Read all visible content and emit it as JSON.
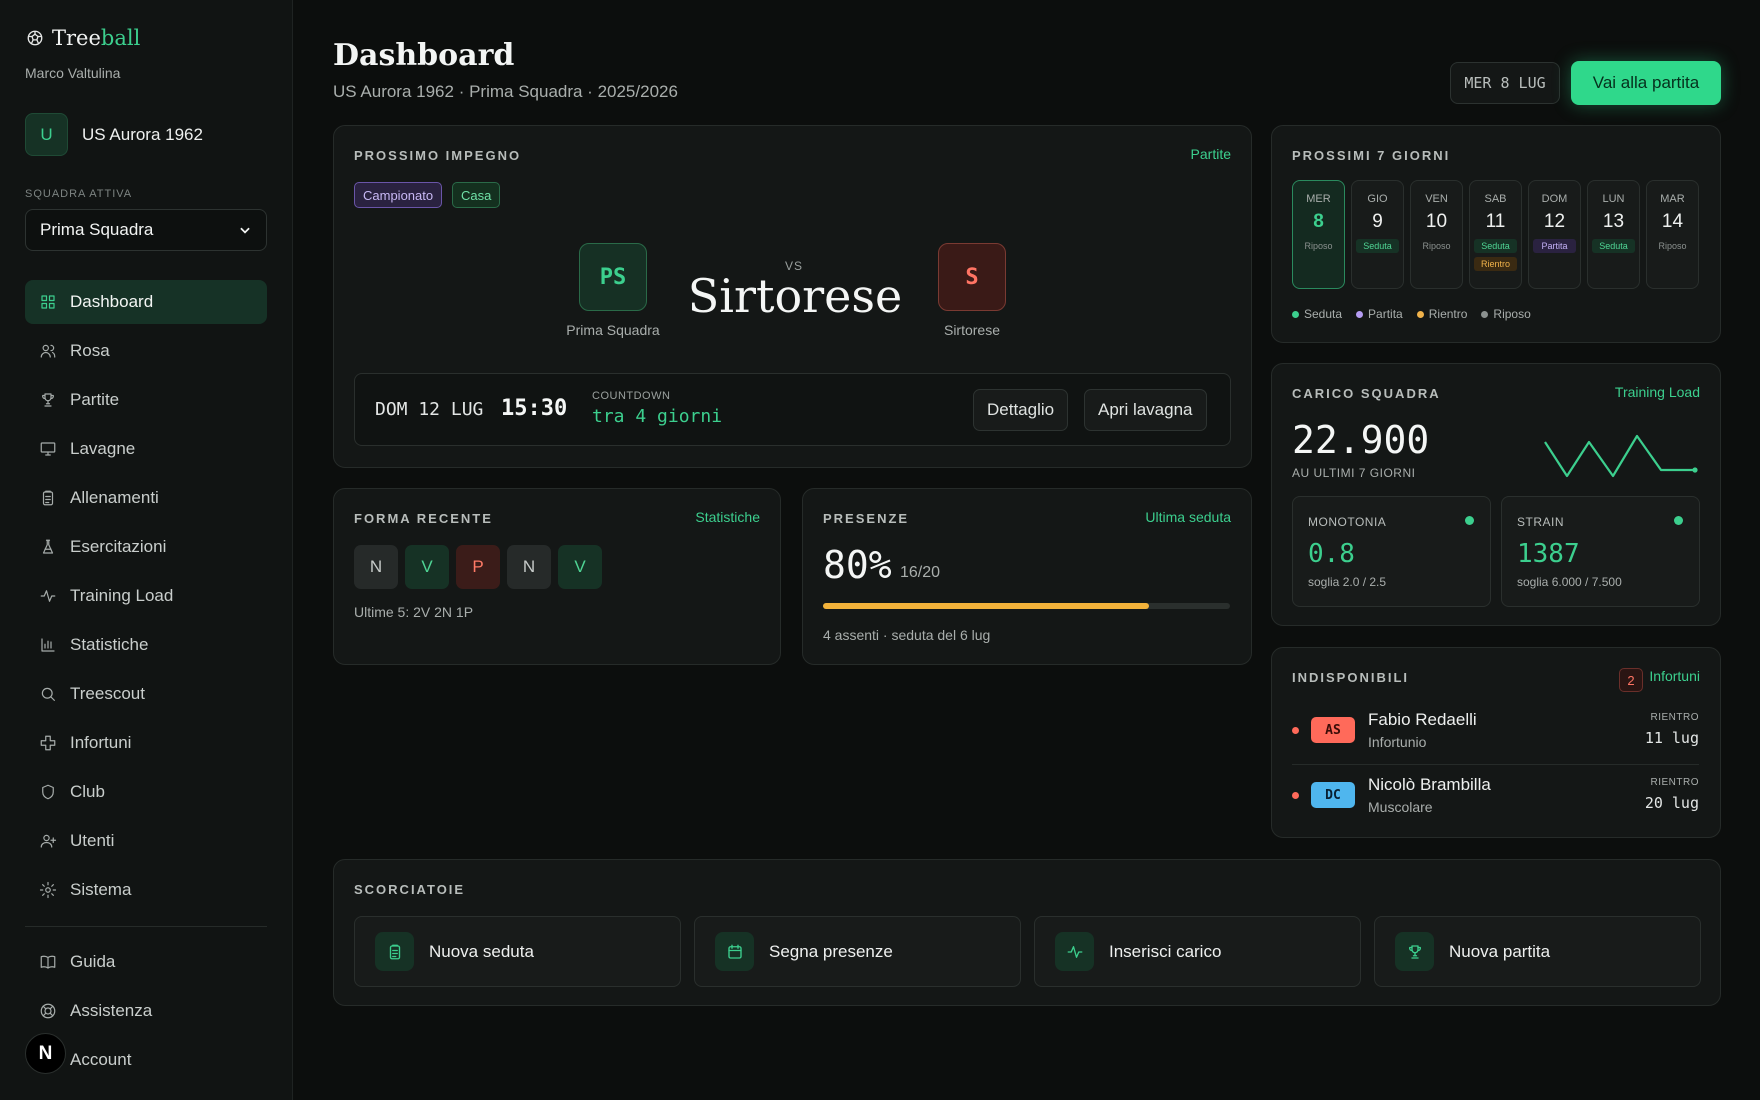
{
  "brand": {
    "name_a": "Tree",
    "name_b": "ball",
    "user": "Marco Valtulina"
  },
  "club": {
    "initial": "U",
    "name": "US Aurora 1962"
  },
  "team_selector": {
    "label": "SQUADRA ATTIVA",
    "value": "Prima Squadra"
  },
  "nav": {
    "items": [
      {
        "label": "Dashboard",
        "icon": "grid-icon",
        "active": true
      },
      {
        "label": "Rosa",
        "icon": "users-icon"
      },
      {
        "label": "Partite",
        "icon": "trophy-icon"
      },
      {
        "label": "Lavagne",
        "icon": "presentation-icon"
      },
      {
        "label": "Allenamenti",
        "icon": "clipboard-icon"
      },
      {
        "label": "Esercitazioni",
        "icon": "flask-icon"
      },
      {
        "label": "Training Load",
        "icon": "activity-icon"
      },
      {
        "label": "Statistiche",
        "icon": "bar-chart-icon"
      },
      {
        "label": "Treescout",
        "icon": "search-icon"
      },
      {
        "label": "Infortuni",
        "icon": "cross-icon"
      },
      {
        "label": "Club",
        "icon": "shield-icon"
      },
      {
        "label": "Utenti",
        "icon": "user-plus-icon"
      },
      {
        "label": "Sistema",
        "icon": "gear-icon"
      }
    ],
    "bottom": [
      {
        "label": "Guida",
        "icon": "book-icon"
      },
      {
        "label": "Assistenza",
        "icon": "lifebuoy-icon"
      },
      {
        "label": "Account",
        "icon": "user-icon"
      }
    ],
    "badge": "N"
  },
  "header": {
    "title": "Dashboard",
    "subtitle": "US Aurora 1962 · Prima Squadra · 2025/2026",
    "date_chip": "MER 8 LUG",
    "cta": "Vai alla partita"
  },
  "next_match": {
    "label": "PROSSIMO IMPEGNO",
    "link": "Partite",
    "tags": [
      "Campionato",
      "Casa"
    ],
    "home": {
      "initials": "PS",
      "name": "Prima Squadra"
    },
    "away": {
      "initials": "S",
      "name": "Sirtorese"
    },
    "vs": "VS",
    "opponent_big": "Sirtorese",
    "date": "DOM 12 LUG",
    "time": "15:30",
    "countdown_label": "COUNTDOWN",
    "countdown": "tra 4 giorni",
    "btn_detail": "Dettaglio",
    "btn_board": "Apri lavagna"
  },
  "form": {
    "label": "FORMA RECENTE",
    "link": "Statistiche",
    "results": [
      "N",
      "V",
      "P",
      "N",
      "V"
    ],
    "summary": "Ultime 5: 2V 2N 1P"
  },
  "attendance": {
    "label": "PRESENZE",
    "link": "Ultima seduta",
    "percent": "80%",
    "ratio": "16/20",
    "fraction": 0.8,
    "note": "4 assenti · seduta del 6 lug"
  },
  "week": {
    "label": "PROSSIMI 7 GIORNI",
    "days": [
      {
        "dow": "MER",
        "num": "8",
        "tags": [
          "Riposo"
        ],
        "today": true
      },
      {
        "dow": "GIO",
        "num": "9",
        "tags": [
          "Seduta"
        ]
      },
      {
        "dow": "VEN",
        "num": "10",
        "tags": [
          "Riposo"
        ]
      },
      {
        "dow": "SAB",
        "num": "11",
        "tags": [
          "Seduta",
          "Rientro"
        ]
      },
      {
        "dow": "DOM",
        "num": "12",
        "tags": [
          "Partita"
        ]
      },
      {
        "dow": "LUN",
        "num": "13",
        "tags": [
          "Seduta"
        ]
      },
      {
        "dow": "MAR",
        "num": "14",
        "tags": [
          "Riposo"
        ]
      }
    ],
    "legend": [
      {
        "label": "Seduta",
        "color": "#3ccf8e"
      },
      {
        "label": "Partita",
        "color": "#b59cf2"
      },
      {
        "label": "Rientro",
        "color": "#f0b24a"
      },
      {
        "label": "Riposo",
        "color": "#8b918f"
      }
    ]
  },
  "load": {
    "label": "CARICO SQUADRA",
    "link": "Training Load",
    "value": "22.900",
    "value_label": "AU ULTIMI 7 GIORNI",
    "monotonia": {
      "label": "MONOTONIA",
      "value": "0.8",
      "sub": "soglia 2.0 / 2.5"
    },
    "strain": {
      "label": "STRAIN",
      "value": "1387",
      "sub": "soglia 6.000 / 7.500"
    }
  },
  "unavailable": {
    "label": "INDISPONIBILI",
    "count": "2",
    "link": "Infortuni",
    "players": [
      {
        "role": "AS",
        "name": "Fabio Redaelli",
        "type": "Infortunio",
        "return_label": "RIENTRO",
        "return_date": "11 lug"
      },
      {
        "role": "DC",
        "name": "Nicolò Brambilla",
        "type": "Muscolare",
        "return_label": "RIENTRO",
        "return_date": "20 lug"
      }
    ]
  },
  "shortcuts": {
    "label": "SCORCIATOIE",
    "items": [
      {
        "label": "Nuova seduta",
        "icon": "clipboard-icon"
      },
      {
        "label": "Segna presenze",
        "icon": "calendar-icon"
      },
      {
        "label": "Inserisci carico",
        "icon": "activity-icon"
      },
      {
        "label": "Nuova partita",
        "icon": "trophy-icon"
      }
    ]
  }
}
